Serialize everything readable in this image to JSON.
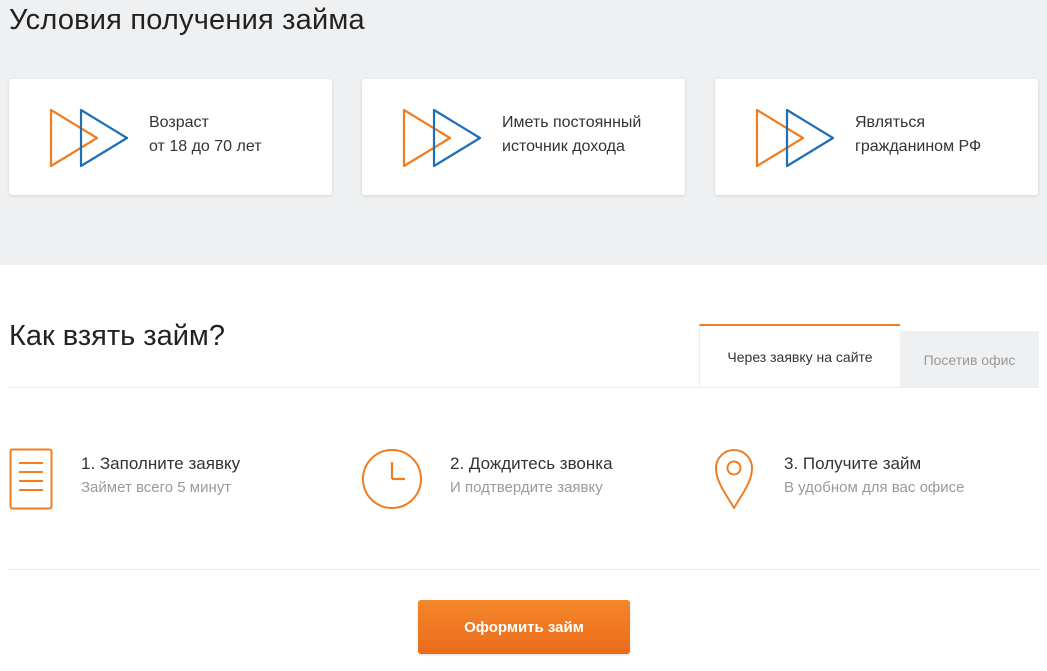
{
  "conditions": {
    "title": "Условия получения займа",
    "cards": [
      {
        "icon": "double-play-icon",
        "line1": "Возраст",
        "line2": "от 18 до 70 лет"
      },
      {
        "icon": "double-play-icon",
        "line1": "Иметь постоянный",
        "line2": "источник дохода"
      },
      {
        "icon": "double-play-icon",
        "line1": "Являться",
        "line2": "гражданином РФ"
      }
    ]
  },
  "howto": {
    "title": "Как взять займ?",
    "tabs": [
      {
        "label": "Через заявку на сайте",
        "active": true
      },
      {
        "label": "Посетив офис",
        "active": false
      }
    ],
    "steps": [
      {
        "icon": "document-icon",
        "title": "1. Заполните заявку",
        "subtitle": "Займет всего 5 минут"
      },
      {
        "icon": "clock-icon",
        "title": "2. Дождитесь звонка",
        "subtitle": "И подтвердите заявку"
      },
      {
        "icon": "map-pin-icon",
        "title": "3. Получите займ",
        "subtitle": "В удобном для вас офисе"
      }
    ],
    "cta_label": "Оформить займ"
  },
  "colors": {
    "accent_orange": "#f07d22",
    "accent_blue": "#1e6fb5",
    "background_gray": "#eef0f2",
    "text_muted": "#9a9a9a"
  }
}
